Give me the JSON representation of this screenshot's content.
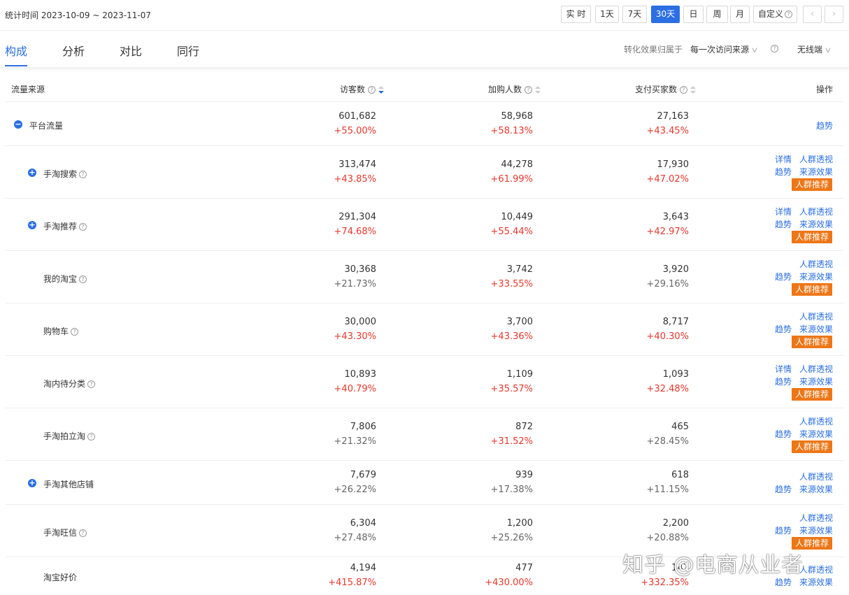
{
  "date_range": {
    "label": "统计时间 2023-10-09 ~ 2023-11-07"
  },
  "period_buttons": [
    "实 时",
    "1天",
    "7天",
    "30天",
    "日",
    "周",
    "月",
    "自定义"
  ],
  "period_active": "30天",
  "tabs": [
    "构成",
    "分析",
    "对比",
    "同行"
  ],
  "tab_active": "构成",
  "options": {
    "attribution_label": "转化效果归属于",
    "attribution_value": "每一次访问来源",
    "device": "无线端"
  },
  "table": {
    "headers": {
      "source": "流量来源",
      "visitors": "访客数",
      "cart": "加购人数",
      "buyers": "支付买家数",
      "actions": "操作"
    },
    "rows": [
      {
        "name": "平台流量",
        "expand": true,
        "help": false,
        "visitors": "601,682",
        "visitors_pct": "+55.00%",
        "cart": "58,968",
        "cart_pct": "+58.13%",
        "buyers": "27,163",
        "buyers_pct": "+43.45%",
        "actions": {
          "trend": "趋势"
        }
      },
      {
        "name": "手淘搜索",
        "expand": true,
        "help": true,
        "visitors": "313,474",
        "visitors_pct": "+43.85%",
        "cart": "44,278",
        "cart_pct": "+61.99%",
        "buyers": "17,930",
        "buyers_pct": "+47.02%",
        "actions": {
          "detail": "详情",
          "crowd": "人群透视",
          "trend": "趋势",
          "source": "来源效果",
          "recommend": "人群推荐"
        }
      },
      {
        "name": "手淘推荐",
        "expand": true,
        "help": true,
        "visitors": "291,304",
        "visitors_pct": "+74.68%",
        "cart": "10,449",
        "cart_pct": "+55.44%",
        "buyers": "3,643",
        "buyers_pct": "+42.97%",
        "actions": {
          "detail": "详情",
          "crowd": "人群透视",
          "trend": "趋势",
          "source": "来源效果",
          "recommend": "人群推荐"
        }
      },
      {
        "name": "我的淘宝",
        "expand": false,
        "help": true,
        "visitors": "30,368",
        "visitors_pct": "+21.73%",
        "cart": "3,742",
        "cart_pct": "+33.55%",
        "buyers": "3,920",
        "buyers_pct": "+29.16%",
        "actions": {
          "crowd": "人群透视",
          "trend": "趋势",
          "source": "来源效果",
          "recommend": "人群推荐"
        }
      },
      {
        "name": "购物车",
        "expand": false,
        "help": true,
        "visitors": "30,000",
        "visitors_pct": "+43.30%",
        "cart": "3,700",
        "cart_pct": "+43.36%",
        "buyers": "8,717",
        "buyers_pct": "+40.30%",
        "actions": {
          "crowd": "人群透视",
          "trend": "趋势",
          "source": "来源效果",
          "recommend": "人群推荐"
        }
      },
      {
        "name": "淘内待分类",
        "expand": false,
        "help": true,
        "visitors": "10,893",
        "visitors_pct": "+40.79%",
        "cart": "1,109",
        "cart_pct": "+35.57%",
        "buyers": "1,093",
        "buyers_pct": "+32.48%",
        "actions": {
          "detail": "详情",
          "crowd": "人群透视",
          "trend": "趋势",
          "source": "来源效果",
          "recommend": "人群推荐"
        }
      },
      {
        "name": "手淘拍立淘",
        "expand": false,
        "help": true,
        "visitors": "7,806",
        "visitors_pct": "+21.32%",
        "cart": "872",
        "cart_pct": "+31.52%",
        "buyers": "465",
        "buyers_pct": "+28.45%",
        "actions": {
          "crowd": "人群透视",
          "trend": "趋势",
          "source": "来源效果",
          "recommend": "人群推荐"
        }
      },
      {
        "name": "手淘其他店铺",
        "expand": true,
        "help": false,
        "visitors": "7,679",
        "visitors_pct": "+26.22%",
        "cart": "939",
        "cart_pct": "+17.38%",
        "buyers": "618",
        "buyers_pct": "+11.15%",
        "actions": {
          "crowd": "人群透视",
          "trend": "趋势",
          "source": "来源效果"
        }
      },
      {
        "name": "手淘旺信",
        "expand": false,
        "help": true,
        "visitors": "6,304",
        "visitors_pct": "+27.48%",
        "cart": "1,200",
        "cart_pct": "+25.26%",
        "buyers": "2,200",
        "buyers_pct": "+20.88%",
        "actions": {
          "crowd": "人群透视",
          "trend": "趋势",
          "source": "来源效果",
          "recommend": "人群推荐"
        }
      },
      {
        "name": "淘宝好价",
        "expand": false,
        "help": false,
        "visitors": "4,194",
        "visitors_pct": "+415.87%",
        "cart": "477",
        "cart_pct": "+430.00%",
        "buyers": "147",
        "buyers_pct": "+332.35%",
        "actions": {
          "crowd": "人群透视",
          "trend": "趋势",
          "source": "来源效果"
        }
      }
    ]
  },
  "watermark": "知乎 @电商从业者",
  "colors": {
    "primary": "#2b6fe3",
    "increase": "#e8372c",
    "badge": "#ee7616"
  }
}
